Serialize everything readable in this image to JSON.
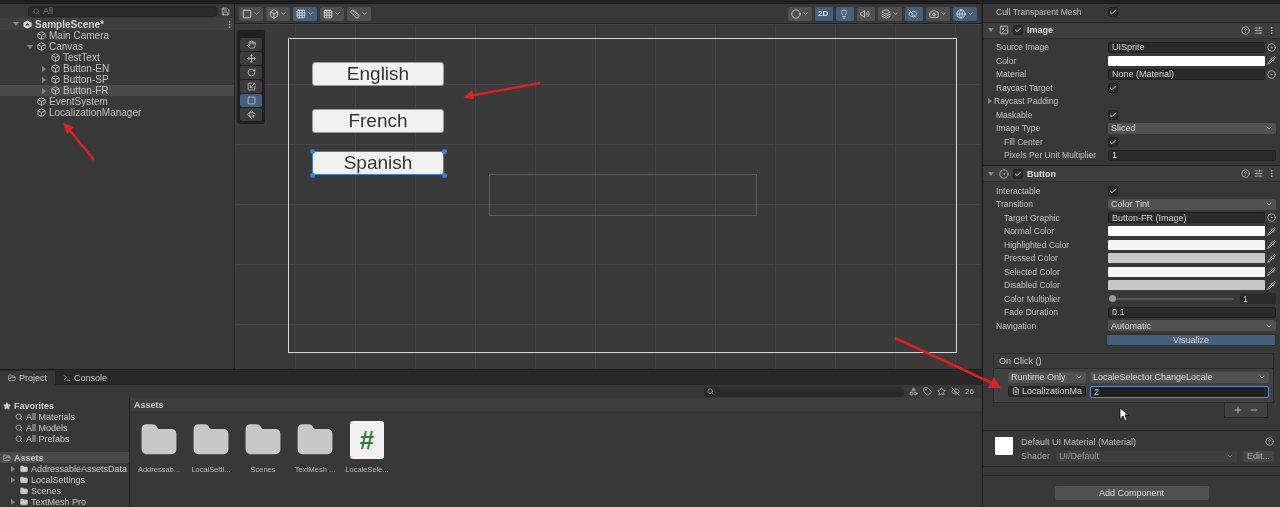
{
  "hierarchy": {
    "search_placeholder": "All",
    "items": [
      {
        "label": "SampleScene*",
        "kind": "scene",
        "expanded": true,
        "selected": false,
        "children": [
          {
            "label": "Main Camera",
            "kind": "object",
            "selected": false
          },
          {
            "label": "Canvas",
            "kind": "object",
            "expanded": true,
            "selected": false,
            "children": [
              {
                "label": "TestText",
                "kind": "object",
                "selected": false
              },
              {
                "label": "Button-EN",
                "kind": "object",
                "expanded": false,
                "selected": false
              },
              {
                "label": "Button-SP",
                "kind": "object",
                "expanded": false,
                "selected": false
              },
              {
                "label": "Button-FR",
                "kind": "object",
                "expanded": false,
                "selected": true
              }
            ]
          },
          {
            "label": "EventSystem",
            "kind": "object",
            "selected": false
          },
          {
            "label": "LocalizationManager",
            "kind": "object",
            "selected": false
          }
        ]
      }
    ]
  },
  "scene": {
    "toolbar_left": [
      {
        "kind": "rect",
        "selected": false,
        "dropdown": true
      },
      {
        "kind": "cube",
        "selected": false,
        "dropdown": true
      },
      {
        "kind": "grid-snap",
        "selected": true,
        "dropdown": true
      },
      {
        "kind": "grid",
        "selected": false,
        "dropdown": true
      },
      {
        "kind": "ruler",
        "selected": false,
        "dropdown": true
      }
    ],
    "toolbar_right": [
      {
        "kind": "shading",
        "selected": false,
        "dropdown": true
      },
      {
        "kind": "text",
        "label": "2D",
        "selected": true,
        "dropdown": false
      },
      {
        "kind": "light",
        "selected": true,
        "dropdown": false
      },
      {
        "kind": "audio",
        "selected": false,
        "dropdown": false
      },
      {
        "kind": "effects",
        "selected": false,
        "dropdown": true
      },
      {
        "kind": "hidden",
        "selected": true,
        "dropdown": false
      },
      {
        "kind": "camera",
        "selected": false,
        "dropdown": true
      },
      {
        "kind": "gizmos",
        "selected": true,
        "dropdown": true
      }
    ],
    "tools": [
      {
        "kind": "hand",
        "selected": false
      },
      {
        "kind": "move",
        "selected": false
      },
      {
        "kind": "rotate",
        "selected": false
      },
      {
        "kind": "scale",
        "selected": false
      },
      {
        "kind": "rect",
        "selected": true
      },
      {
        "kind": "transform",
        "selected": false
      }
    ],
    "buttons": [
      {
        "label": "English",
        "selected": false
      },
      {
        "label": "French",
        "selected": false
      },
      {
        "label": "Spanish",
        "selected": true
      }
    ]
  },
  "inspector": {
    "top_rows": [
      {
        "kind": "checkbox",
        "label": "Cull Transparent Mesh",
        "checked": true
      }
    ],
    "components": [
      {
        "title": "Image",
        "kind": "image",
        "enabled": true,
        "rows": [
          {
            "kind": "object",
            "label": "Source Image",
            "value": "UISprite"
          },
          {
            "kind": "color",
            "label": "Color",
            "color": "#ffffff"
          },
          {
            "kind": "object",
            "label": "Material",
            "value": "None (Material)"
          },
          {
            "kind": "checkbox",
            "label": "Raycast Target",
            "checked": true
          },
          {
            "kind": "foldout",
            "label": "Raycast Padding",
            "expanded": false
          },
          {
            "kind": "checkbox",
            "label": "Maskable",
            "checked": true
          },
          {
            "kind": "dropdown",
            "label": "Image Type",
            "value": "Sliced",
            "children": [
              {
                "kind": "checkbox",
                "label": "Fill Center",
                "checked": true
              },
              {
                "kind": "number",
                "label": "Pixels Per Unit Multiplier",
                "value": "1"
              }
            ]
          }
        ]
      },
      {
        "title": "Button",
        "kind": "button",
        "enabled": true,
        "rows": [
          {
            "kind": "checkbox",
            "label": "Interactable",
            "checked": true
          },
          {
            "kind": "dropdown",
            "label": "Transition",
            "value": "Color Tint",
            "children": [
              {
                "kind": "object",
                "label": "Target Graphic",
                "value": "Button-FR (Image)"
              },
              {
                "kind": "color",
                "label": "Normal Color",
                "color": "#ffffff"
              },
              {
                "kind": "color",
                "label": "Highlighted Color",
                "color": "#f5f5f5"
              },
              {
                "kind": "color",
                "label": "Pressed Color",
                "color": "#c8c8c8"
              },
              {
                "kind": "color",
                "label": "Selected Color",
                "color": "#f5f5f5"
              },
              {
                "kind": "color",
                "label": "Disabled Color",
                "color": "#c8c8c8"
              },
              {
                "kind": "slider",
                "label": "Color Multiplier",
                "level": 0,
                "value": "1"
              },
              {
                "kind": "number",
                "label": "Fade Duration",
                "value": "0.1"
              }
            ]
          },
          {
            "kind": "dropdown",
            "label": "Navigation",
            "value": "Automatic"
          },
          {
            "kind": "button",
            "label": "Visualize"
          }
        ]
      }
    ],
    "on_click": {
      "title": "On Click ()",
      "mode": "Runtime Only",
      "function": "LocaleSelector.ChangeLocale",
      "object": "LocalizationMa",
      "argument": "2"
    },
    "material": {
      "title": "Default UI Material (Material)",
      "shader_label": "Shader",
      "shader": "UI/Default",
      "edit": "Edit..."
    },
    "add_button": "Add Component"
  },
  "project": {
    "tabs": [
      {
        "label": "Project",
        "selected": true
      },
      {
        "label": "Console",
        "selected": false
      }
    ],
    "hidden_count": "26",
    "favorites": {
      "title": "Favorites",
      "items": [
        "All Materials",
        "All Models",
        "All Prefabs"
      ]
    },
    "assets_tree": {
      "label": "Assets",
      "selected": true,
      "children": [
        {
          "label": "AddressableAssetsData",
          "expanded": false
        },
        {
          "label": "LocalSettings",
          "expanded": false
        },
        {
          "label": "Scenes"
        },
        {
          "label": "TextMesh Pro",
          "expanded": false
        }
      ]
    },
    "breadcrumb": "Assets",
    "assets": [
      {
        "label": "Addressab...",
        "kind": "folder"
      },
      {
        "label": "LocalSetti...",
        "kind": "folder"
      },
      {
        "label": "Scenes",
        "kind": "folder"
      },
      {
        "label": "TextMesh ...",
        "kind": "folder"
      },
      {
        "label": "LocaleSele...",
        "kind": "script",
        "glyph": "#"
      }
    ]
  }
}
